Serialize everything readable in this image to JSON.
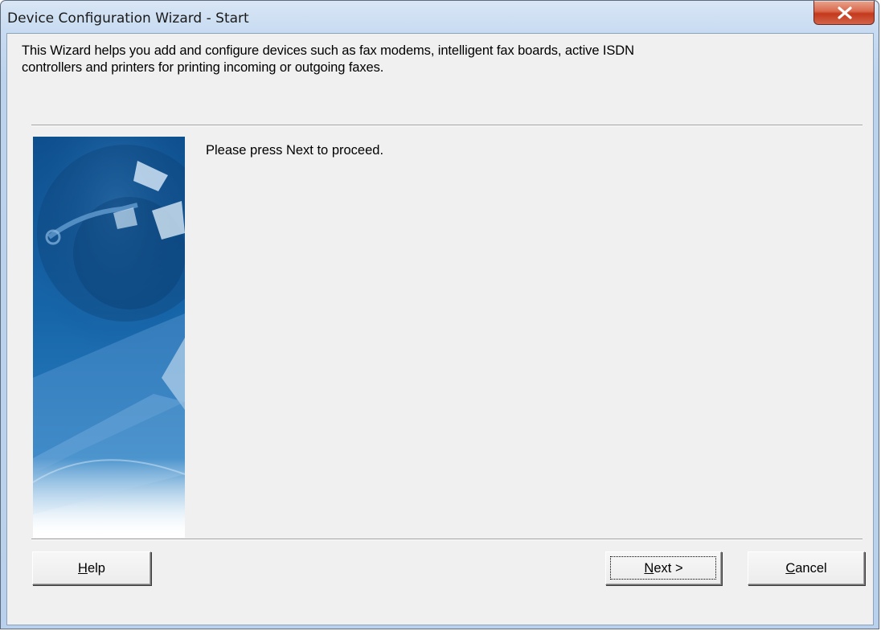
{
  "window": {
    "title": "Device Configuration Wizard - Start"
  },
  "content": {
    "intro_line1": "This Wizard helps you add and configure devices such as fax modems, intelligent fax boards, active ISDN",
    "intro_line2": "controllers and printers for printing incoming or outgoing faxes.",
    "prompt": "Please press Next to proceed."
  },
  "buttons": {
    "help": {
      "mnemonic": "H",
      "rest": "elp"
    },
    "next": {
      "mnemonic": "N",
      "rest": "ext >"
    },
    "cancel": {
      "mnemonic": "C",
      "rest": "ancel"
    }
  },
  "icons": {
    "close": "close-icon",
    "banner": "wizard-banner-image"
  },
  "colors": {
    "client_bg": "#f0f0f0",
    "close_red": "#c4391c",
    "banner_blue": "#1a5d9c"
  }
}
